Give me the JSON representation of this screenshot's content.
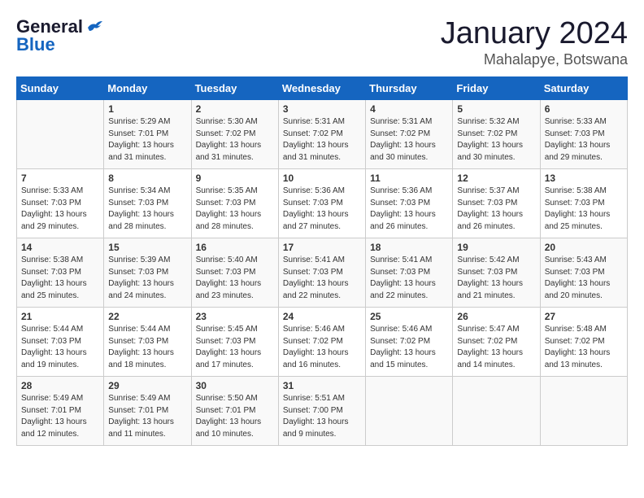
{
  "logo": {
    "general": "General",
    "blue": "Blue"
  },
  "title": "January 2024",
  "subtitle": "Mahalapye, Botswana",
  "days_header": [
    "Sunday",
    "Monday",
    "Tuesday",
    "Wednesday",
    "Thursday",
    "Friday",
    "Saturday"
  ],
  "weeks": [
    [
      {
        "day": "",
        "sunrise": "",
        "sunset": "",
        "daylight": ""
      },
      {
        "day": "1",
        "sunrise": "Sunrise: 5:29 AM",
        "sunset": "Sunset: 7:01 PM",
        "daylight": "Daylight: 13 hours and 31 minutes."
      },
      {
        "day": "2",
        "sunrise": "Sunrise: 5:30 AM",
        "sunset": "Sunset: 7:02 PM",
        "daylight": "Daylight: 13 hours and 31 minutes."
      },
      {
        "day": "3",
        "sunrise": "Sunrise: 5:31 AM",
        "sunset": "Sunset: 7:02 PM",
        "daylight": "Daylight: 13 hours and 31 minutes."
      },
      {
        "day": "4",
        "sunrise": "Sunrise: 5:31 AM",
        "sunset": "Sunset: 7:02 PM",
        "daylight": "Daylight: 13 hours and 30 minutes."
      },
      {
        "day": "5",
        "sunrise": "Sunrise: 5:32 AM",
        "sunset": "Sunset: 7:02 PM",
        "daylight": "Daylight: 13 hours and 30 minutes."
      },
      {
        "day": "6",
        "sunrise": "Sunrise: 5:33 AM",
        "sunset": "Sunset: 7:03 PM",
        "daylight": "Daylight: 13 hours and 29 minutes."
      }
    ],
    [
      {
        "day": "7",
        "sunrise": "Sunrise: 5:33 AM",
        "sunset": "Sunset: 7:03 PM",
        "daylight": "Daylight: 13 hours and 29 minutes."
      },
      {
        "day": "8",
        "sunrise": "Sunrise: 5:34 AM",
        "sunset": "Sunset: 7:03 PM",
        "daylight": "Daylight: 13 hours and 28 minutes."
      },
      {
        "day": "9",
        "sunrise": "Sunrise: 5:35 AM",
        "sunset": "Sunset: 7:03 PM",
        "daylight": "Daylight: 13 hours and 28 minutes."
      },
      {
        "day": "10",
        "sunrise": "Sunrise: 5:36 AM",
        "sunset": "Sunset: 7:03 PM",
        "daylight": "Daylight: 13 hours and 27 minutes."
      },
      {
        "day": "11",
        "sunrise": "Sunrise: 5:36 AM",
        "sunset": "Sunset: 7:03 PM",
        "daylight": "Daylight: 13 hours and 26 minutes."
      },
      {
        "day": "12",
        "sunrise": "Sunrise: 5:37 AM",
        "sunset": "Sunset: 7:03 PM",
        "daylight": "Daylight: 13 hours and 26 minutes."
      },
      {
        "day": "13",
        "sunrise": "Sunrise: 5:38 AM",
        "sunset": "Sunset: 7:03 PM",
        "daylight": "Daylight: 13 hours and 25 minutes."
      }
    ],
    [
      {
        "day": "14",
        "sunrise": "Sunrise: 5:38 AM",
        "sunset": "Sunset: 7:03 PM",
        "daylight": "Daylight: 13 hours and 25 minutes."
      },
      {
        "day": "15",
        "sunrise": "Sunrise: 5:39 AM",
        "sunset": "Sunset: 7:03 PM",
        "daylight": "Daylight: 13 hours and 24 minutes."
      },
      {
        "day": "16",
        "sunrise": "Sunrise: 5:40 AM",
        "sunset": "Sunset: 7:03 PM",
        "daylight": "Daylight: 13 hours and 23 minutes."
      },
      {
        "day": "17",
        "sunrise": "Sunrise: 5:41 AM",
        "sunset": "Sunset: 7:03 PM",
        "daylight": "Daylight: 13 hours and 22 minutes."
      },
      {
        "day": "18",
        "sunrise": "Sunrise: 5:41 AM",
        "sunset": "Sunset: 7:03 PM",
        "daylight": "Daylight: 13 hours and 22 minutes."
      },
      {
        "day": "19",
        "sunrise": "Sunrise: 5:42 AM",
        "sunset": "Sunset: 7:03 PM",
        "daylight": "Daylight: 13 hours and 21 minutes."
      },
      {
        "day": "20",
        "sunrise": "Sunrise: 5:43 AM",
        "sunset": "Sunset: 7:03 PM",
        "daylight": "Daylight: 13 hours and 20 minutes."
      }
    ],
    [
      {
        "day": "21",
        "sunrise": "Sunrise: 5:44 AM",
        "sunset": "Sunset: 7:03 PM",
        "daylight": "Daylight: 13 hours and 19 minutes."
      },
      {
        "day": "22",
        "sunrise": "Sunrise: 5:44 AM",
        "sunset": "Sunset: 7:03 PM",
        "daylight": "Daylight: 13 hours and 18 minutes."
      },
      {
        "day": "23",
        "sunrise": "Sunrise: 5:45 AM",
        "sunset": "Sunset: 7:03 PM",
        "daylight": "Daylight: 13 hours and 17 minutes."
      },
      {
        "day": "24",
        "sunrise": "Sunrise: 5:46 AM",
        "sunset": "Sunset: 7:02 PM",
        "daylight": "Daylight: 13 hours and 16 minutes."
      },
      {
        "day": "25",
        "sunrise": "Sunrise: 5:46 AM",
        "sunset": "Sunset: 7:02 PM",
        "daylight": "Daylight: 13 hours and 15 minutes."
      },
      {
        "day": "26",
        "sunrise": "Sunrise: 5:47 AM",
        "sunset": "Sunset: 7:02 PM",
        "daylight": "Daylight: 13 hours and 14 minutes."
      },
      {
        "day": "27",
        "sunrise": "Sunrise: 5:48 AM",
        "sunset": "Sunset: 7:02 PM",
        "daylight": "Daylight: 13 hours and 13 minutes."
      }
    ],
    [
      {
        "day": "28",
        "sunrise": "Sunrise: 5:49 AM",
        "sunset": "Sunset: 7:01 PM",
        "daylight": "Daylight: 13 hours and 12 minutes."
      },
      {
        "day": "29",
        "sunrise": "Sunrise: 5:49 AM",
        "sunset": "Sunset: 7:01 PM",
        "daylight": "Daylight: 13 hours and 11 minutes."
      },
      {
        "day": "30",
        "sunrise": "Sunrise: 5:50 AM",
        "sunset": "Sunset: 7:01 PM",
        "daylight": "Daylight: 13 hours and 10 minutes."
      },
      {
        "day": "31",
        "sunrise": "Sunrise: 5:51 AM",
        "sunset": "Sunset: 7:00 PM",
        "daylight": "Daylight: 13 hours and 9 minutes."
      },
      {
        "day": "",
        "sunrise": "",
        "sunset": "",
        "daylight": ""
      },
      {
        "day": "",
        "sunrise": "",
        "sunset": "",
        "daylight": ""
      },
      {
        "day": "",
        "sunrise": "",
        "sunset": "",
        "daylight": ""
      }
    ]
  ]
}
